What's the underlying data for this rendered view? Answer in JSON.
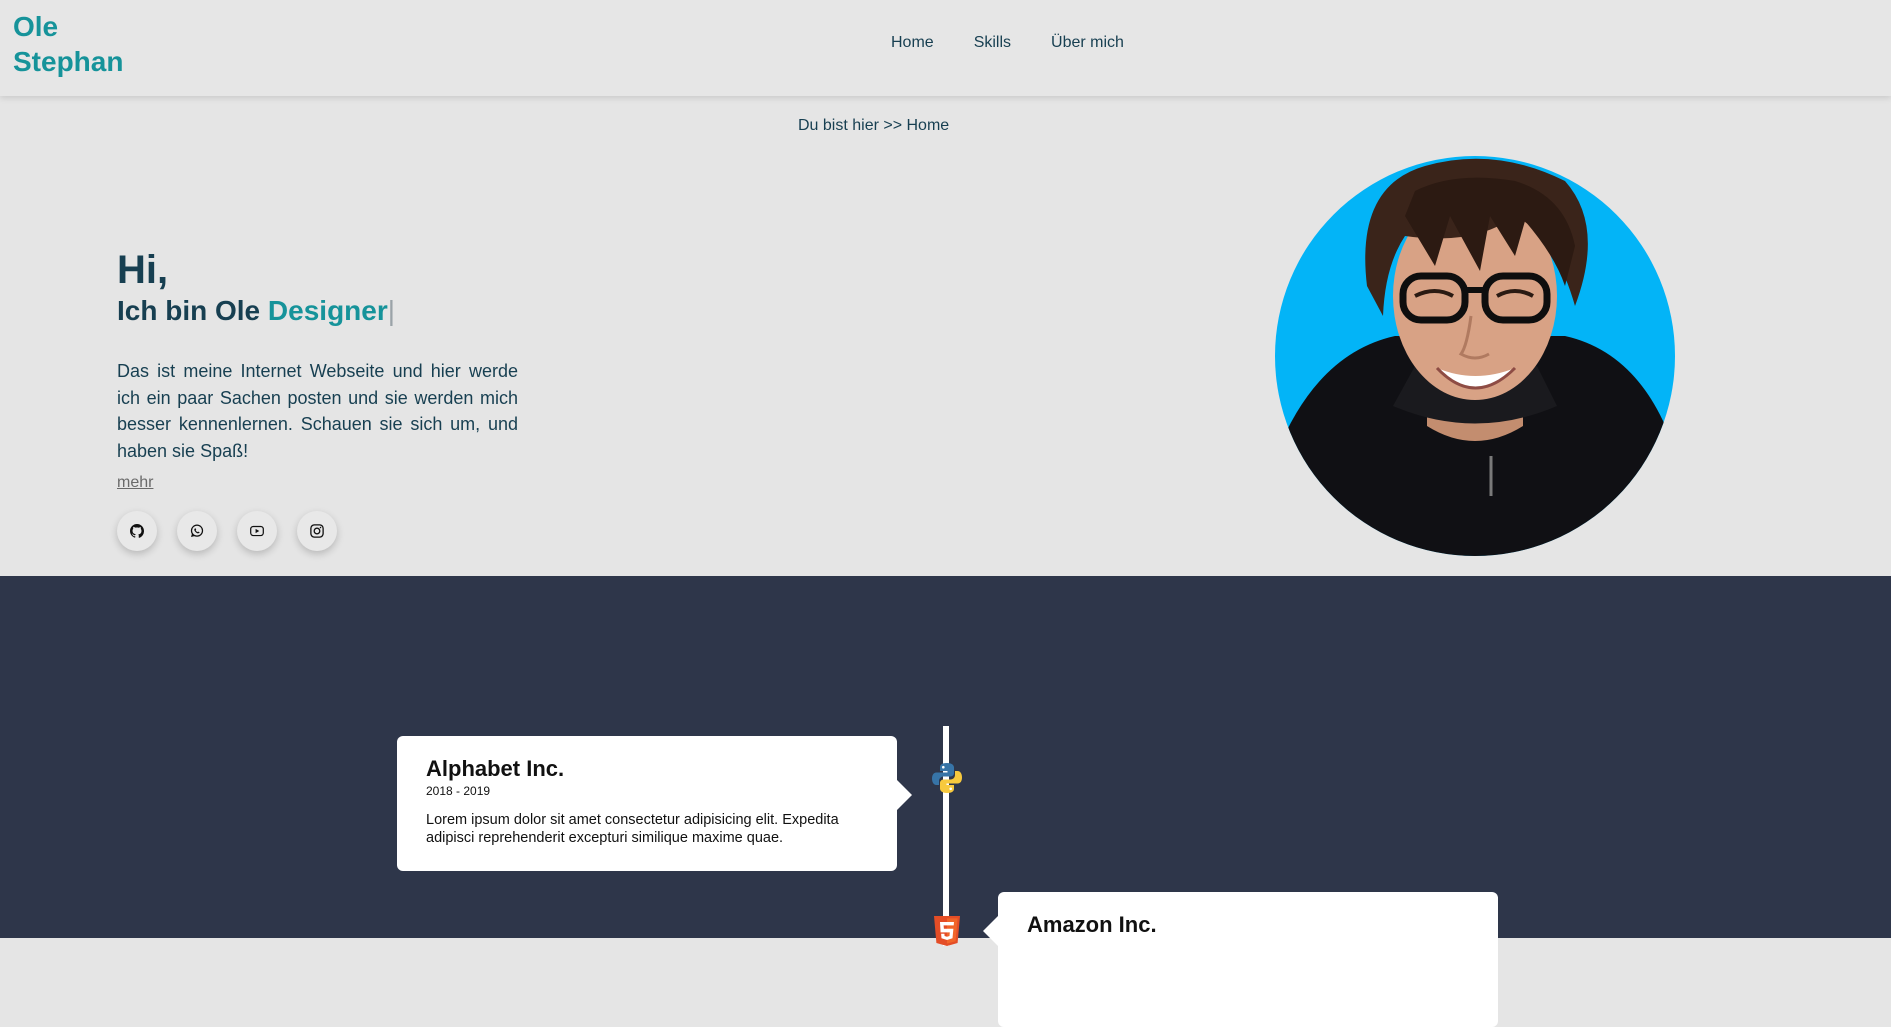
{
  "brand": {
    "line1": "Ole",
    "line2": "Stephan",
    "color": "#16939a"
  },
  "nav": [
    {
      "label": "Home"
    },
    {
      "label": "Skills"
    },
    {
      "label": "Über mich"
    }
  ],
  "breadcrumb": "Du bist hier >> Home",
  "hero": {
    "greeting": "Hi,",
    "intro_prefix": "Ich bin Ole ",
    "role": "Designer",
    "cursor": "|",
    "description": "Das ist meine Internet Webseite und hier werde ich ein paar Sachen posten und sie werden mich besser kennenlernen. Schauen sie sich um, und haben sie Spaß!",
    "more_label": "mehr",
    "socials": [
      {
        "icon": "github-icon"
      },
      {
        "icon": "whatsapp-icon"
      },
      {
        "icon": "youtube-icon"
      },
      {
        "icon": "instagram-icon"
      }
    ]
  },
  "timeline": [
    {
      "company": "Alphabet Inc.",
      "years": "2018 - 2019",
      "text": "Lorem ipsum dolor sit amet consectetur adipisicing elit. Expedita adipisci reprehenderit excepturi similique maxime quae.",
      "icon": "python-icon"
    },
    {
      "company": "Amazon Inc.",
      "years": "",
      "text": "",
      "icon": "html5-icon"
    }
  ],
  "colors": {
    "accent": "#16939a",
    "text": "#173f51",
    "dark_section": "#2e364a",
    "avatar_bg": "#03b4f7"
  }
}
